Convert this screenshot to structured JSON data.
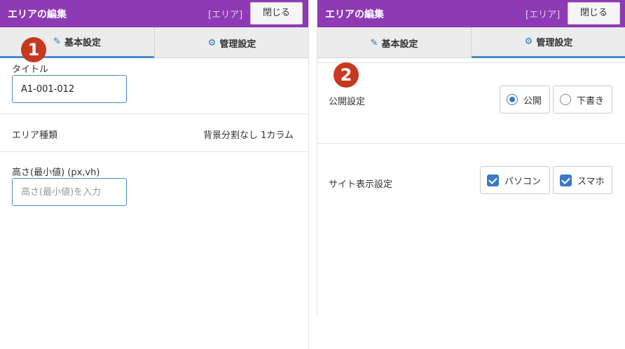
{
  "left": {
    "header": {
      "title": "エリアの編集",
      "area_tag": "[エリア]",
      "close_label": "閉じる"
    },
    "tabs": [
      {
        "label": "基本設定",
        "icon": "edit-icon"
      },
      {
        "label": "管理設定",
        "icon": "gear-icon"
      }
    ],
    "active_tab": "基本設定",
    "badge": "1",
    "title_field": {
      "label": "タイトル",
      "value": "A1-001-012"
    },
    "area_type": {
      "label": "エリア種類",
      "value": "背景分割なし 1カラム"
    },
    "height_field": {
      "label": "高さ(最小値) (px,vh)",
      "placeholder": "高さ(最小値)を入力"
    }
  },
  "right": {
    "header": {
      "title": "エリアの編集",
      "area_tag": "[エリア]",
      "close_label": "閉じる"
    },
    "tabs": [
      {
        "label": "基本設定",
        "icon": "edit-icon"
      },
      {
        "label": "管理設定",
        "icon": "gear-icon"
      }
    ],
    "active_tab": "管理設定",
    "badge": "2",
    "publish": {
      "label": "公開設定",
      "options": [
        {
          "label": "公開",
          "selected": true
        },
        {
          "label": "下書き",
          "selected": false
        }
      ]
    },
    "display": {
      "label": "サイト表示設定",
      "options": [
        {
          "label": "パソコン",
          "checked": true
        },
        {
          "label": "スマホ",
          "checked": true
        }
      ]
    }
  }
}
